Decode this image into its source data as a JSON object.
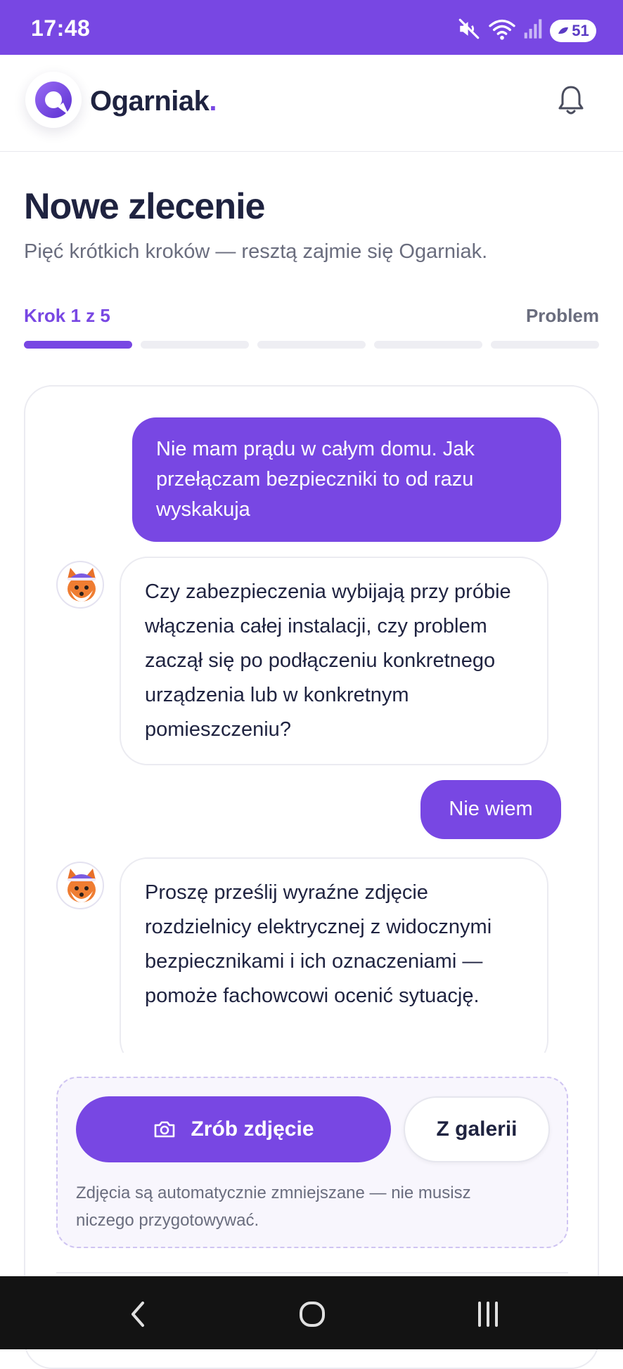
{
  "status_bar": {
    "time": "17:48",
    "battery": "51",
    "icons": [
      "mute-icon",
      "wifi-icon",
      "signal-icon",
      "battery-icon"
    ]
  },
  "app_bar": {
    "brand": "Ogarniak",
    "brand_dot": ".",
    "accent": "#7847e3"
  },
  "header": {
    "title": "Nowe zlecenie",
    "subtitle": "Pięć krótkich kroków — resztą zajmie się Ogarniak."
  },
  "stepper": {
    "label": "Krok 1 z 5",
    "step_name": "Problem",
    "current_step": 1,
    "total_steps": 5
  },
  "chat": {
    "messages": [
      {
        "role": "user",
        "text": "Nie mam prądu w całym domu. Jak przełączam bezpieczniki to od razu wyskakuja"
      },
      {
        "role": "bot",
        "text": "Czy zabezpieczenia wybijają przy próbie włączenia całej instalacji, czy problem zaczął się po podłączeniu konkretnego urządzenia lub w konkretnym pomieszczeniu?"
      },
      {
        "role": "user",
        "text": "Nie wiem"
      },
      {
        "role": "bot",
        "text": "Proszę prześlij wyraźne zdjęcie rozdzielnicy elektrycznej z widocznymi bezpiecznikami i ich oznaczeniami — pomoże fachowcowi ocenić sytuację."
      }
    ]
  },
  "photo_upload": {
    "take_photo_label": "Zrób zdjęcie",
    "gallery_label": "Z galerii",
    "hint": "Zdjęcia są automatycznie zmniejszane — nie musisz niczego przygotowywać."
  }
}
